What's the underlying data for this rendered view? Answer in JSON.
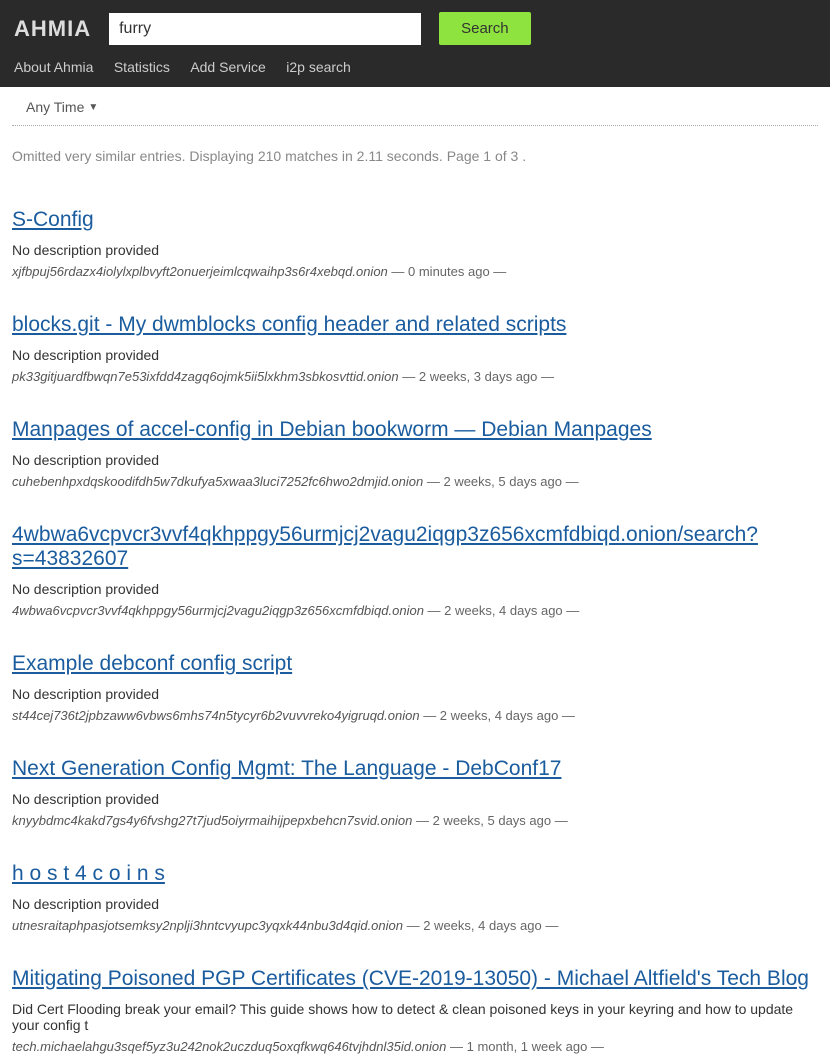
{
  "logo": "AHMIA",
  "search": {
    "value": "furry",
    "button": "Search"
  },
  "nav": {
    "about": "About Ahmia",
    "statistics": "Statistics",
    "add": "Add Service",
    "i2p": "i2p search"
  },
  "filter": {
    "anytime": "Any Time"
  },
  "status": "Omitted very similar entries. Displaying 210 matches in 2.11 seconds. Page 1 of 3 .",
  "results": [
    {
      "title": "S-Config",
      "desc": "No description provided",
      "url": "xjfbpuj56rdazx4iolylxplbvyft2onuerjeimlcqwaihp3s6r4xebqd.onion",
      "time": "0 minutes ago"
    },
    {
      "title": "blocks.git - My dwmblocks config header and related scripts",
      "desc": "No description provided",
      "url": "pk33gitjuardfbwqn7e53ixfdd4zagq6ojmk5ii5lxkhm3sbkosvttid.onion",
      "time": "2 weeks, 3 days ago"
    },
    {
      "title": "Manpages of accel-config in Debian bookworm — Debian Manpages",
      "desc": "No description provided",
      "url": "cuhebenhpxdqskoodifdh5w7dkufya5xwaa3luci7252fc6hwo2dmjid.onion",
      "time": "2 weeks, 5 days ago"
    },
    {
      "title": "4wbwa6vcpvcr3vvf4qkhppgy56urmjcj2vagu2iqgp3z656xcmfdbiqd.onion/search?s=43832607",
      "desc": "No description provided",
      "url": "4wbwa6vcpvcr3vvf4qkhppgy56urmjcj2vagu2iqgp3z656xcmfdbiqd.onion",
      "time": "2 weeks, 4 days ago"
    },
    {
      "title": "Example debconf config script",
      "desc": "No description provided",
      "url": "st44cej736t2jpbzaww6vbws6mhs74n5tycyr6b2vuvvreko4yigruqd.onion",
      "time": "2 weeks, 4 days ago"
    },
    {
      "title": "Next Generation Config Mgmt: The Language - DebConf17",
      "desc": "No description provided",
      "url": "knyybdmc4kakd7gs4y6fvshg27t7jud5oiyrmaihijpepxbehcn7svid.onion",
      "time": "2 weeks, 5 days ago"
    },
    {
      "title": "h o s t 4 c o i n s",
      "desc": "No description provided",
      "url": "utnesraitaphpasjotsemksy2nplji3hntcvyupc3yqxk44nbu3d4qid.onion",
      "time": "2 weeks, 4 days ago"
    },
    {
      "title": "Mitigating Poisoned PGP Certificates (CVE-2019-13050) - Michael Altfield's Tech Blog",
      "desc": "Did Cert Flooding break your email? This guide shows how to detect & clean poisoned keys in your keyring and how to update your config t",
      "url": "tech.michaelahgu3sqef5yz3u242nok2uczduq5oxqfkwq646tvjhdnl35id.onion",
      "time": "1 month, 1 week ago"
    }
  ]
}
